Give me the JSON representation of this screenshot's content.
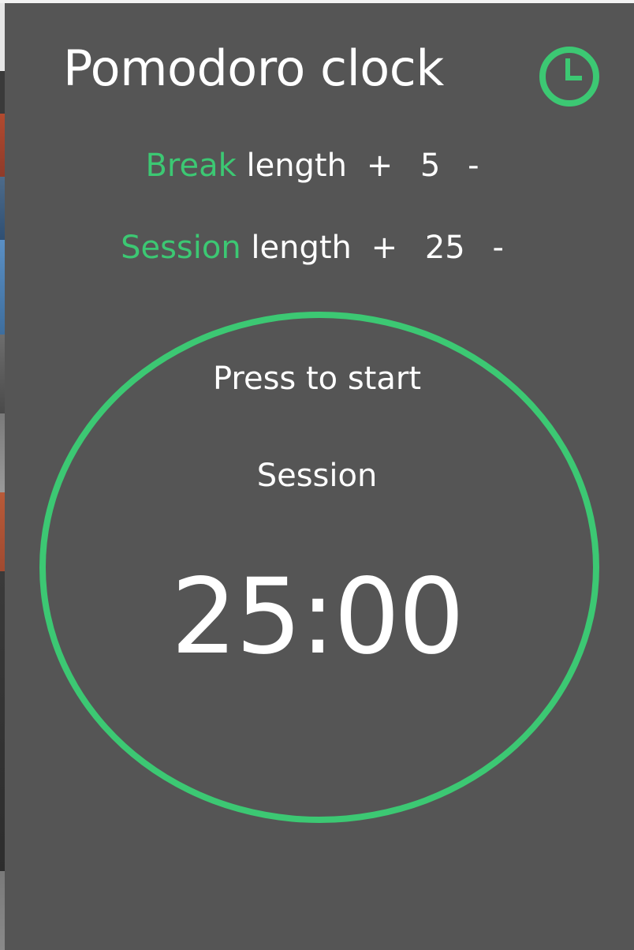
{
  "app": {
    "title": "Pomodoro clock",
    "icon": "clock-icon",
    "accent_color": "#3cc873",
    "background_color": "#555555"
  },
  "break_setting": {
    "label_accent": "Break",
    "label_rest": "length",
    "increment_label": "+",
    "value": "5",
    "decrement_label": "-"
  },
  "session_setting": {
    "label_accent": "Session",
    "label_rest": "length",
    "increment_label": "+",
    "value": "25",
    "decrement_label": "-"
  },
  "timer": {
    "prompt": "Press to start",
    "mode": "Session",
    "time": "25:00"
  }
}
